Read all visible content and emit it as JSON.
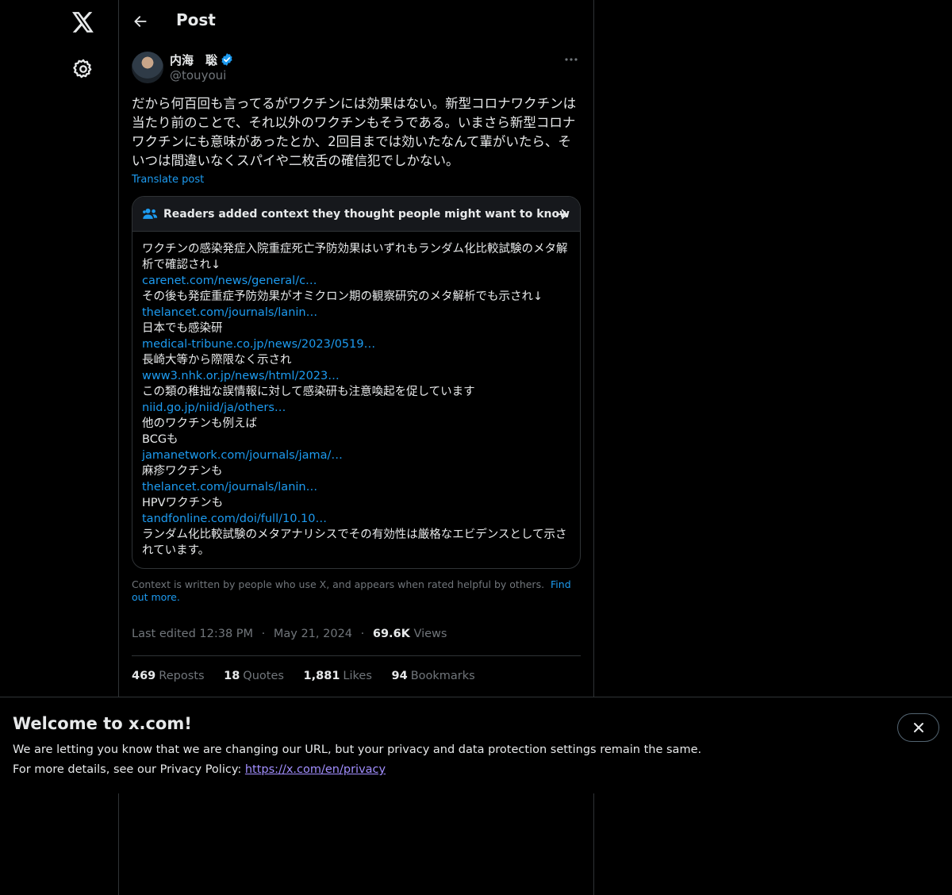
{
  "header": {
    "title": "Post"
  },
  "author": {
    "display_name": "内海　聡",
    "handle": "@touyoui"
  },
  "post": {
    "text": "だから何百回も言ってるがワクチンには効果はない。新型コロナワクチンは当たり前のことで、それ以外のワクチンもそうである。いまさら新型コロナワクチンにも意味があったとか、2回目までは効いたなんて輩がいたら、そいつは間違いなくスパイや二枚舌の確信犯でしかない。",
    "translate_label": "Translate post"
  },
  "note": {
    "title": "Readers added context they thought people might want to know",
    "lines": [
      {
        "type": "text",
        "value": "ワクチンの感染発症入院重症死亡予防効果はいずれもランダム化比較試験のメタ解析で確認され↓"
      },
      {
        "type": "link",
        "value": "carenet.com/news/general/c…"
      },
      {
        "type": "text",
        "value": "その後も発症重症予防効果がオミクロン期の観察研究のメタ解析でも示され↓"
      },
      {
        "type": "link",
        "value": "thelancet.com/journals/lanin…"
      },
      {
        "type": "text",
        "value": "日本でも感染研"
      },
      {
        "type": "link",
        "value": "medical-tribune.co.jp/news/2023/0519…"
      },
      {
        "type": "text",
        "value": "長崎大等から際限なく示され"
      },
      {
        "type": "link",
        "value": "www3.nhk.or.jp/news/html/2023…"
      },
      {
        "type": "text",
        "value": "この類の稚拙な誤情報に対して感染研も注意喚起を促しています"
      },
      {
        "type": "link",
        "value": "niid.go.jp/niid/ja/others…"
      },
      {
        "type": "text",
        "value": "他のワクチンも例えば"
      },
      {
        "type": "text",
        "value": "BCGも"
      },
      {
        "type": "link",
        "value": "jamanetwork.com/journals/jama/…"
      },
      {
        "type": "text",
        "value": "麻疹ワクチンも"
      },
      {
        "type": "link",
        "value": "thelancet.com/journals/lanin…"
      },
      {
        "type": "text",
        "value": "HPVワクチンも"
      },
      {
        "type": "link",
        "value": "tandfonline.com/doi/full/10.10…"
      },
      {
        "type": "text",
        "value": "ランダム化比較試験のメタアナリシスでその有効性は厳格なエビデンスとして示されています。"
      }
    ],
    "footer_text": "Context is written by people who use X, and appears when rated helpful by others.",
    "footer_link": "Find out more."
  },
  "meta": {
    "edited": "Last edited 12:38 PM",
    "sep": "·",
    "date": "May 21, 2024",
    "views_count": "69.6K",
    "views_label": "Views"
  },
  "stats": {
    "reposts": {
      "count": "469",
      "label": "Reposts"
    },
    "quotes": {
      "count": "18",
      "label": "Quotes"
    },
    "likes": {
      "count": "1,881",
      "label": "Likes"
    },
    "bookmarks": {
      "count": "94",
      "label": "Bookmarks"
    }
  },
  "banner": {
    "title": "Welcome to x.com!",
    "line1": "We are letting you know that we are changing our URL, but your privacy and data protection settings remain the same.",
    "line2_prefix": "For more details, see our Privacy Policy: ",
    "privacy_link": "https://x.com/en/privacy"
  },
  "icons": {
    "logo": "x-logo-icon",
    "settings": "gear-icon",
    "back": "back-arrow-icon",
    "verified": "verified-badge-icon",
    "more": "more-dots-icon",
    "community": "people-icon",
    "arrow": "arrow-right-icon",
    "close": "close-icon"
  },
  "colors": {
    "background": "#000000",
    "accent": "#1d9bf0",
    "text_primary": "#e7e9ea",
    "text_secondary": "#71767b",
    "border": "#2f3336",
    "privacy_link": "#a28fff"
  }
}
